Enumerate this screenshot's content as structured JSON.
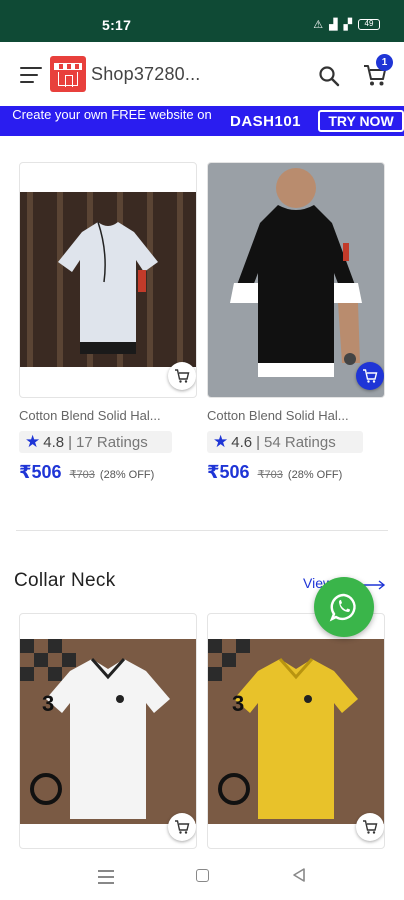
{
  "status_bar": {
    "time": "5:17",
    "battery": "49"
  },
  "header": {
    "shop_name": "Shop37280...",
    "cart_count": "1"
  },
  "promo": {
    "text": "Create your own FREE website on",
    "code": "DASH101",
    "button": "TRY NOW"
  },
  "products_top": [
    {
      "name": "Cotton Blend Solid Hal...",
      "rating": "4.8",
      "ratings_count": "17 Ratings",
      "price": "₹506",
      "old_price": "₹703",
      "discount": "(28% OFF)"
    },
    {
      "name": "Cotton Blend Solid Hal...",
      "rating": "4.6",
      "ratings_count": "54 Ratings",
      "price": "₹506",
      "old_price": "₹703",
      "discount": "(28% OFF)"
    }
  ],
  "section": {
    "title": "Collar Neck",
    "view_all": "View All"
  },
  "colors": {
    "brand_blue": "#1f35d6",
    "status_green": "#0f4a35",
    "whatsapp_green": "#3ab54a",
    "logo_red": "#e8403c"
  },
  "icons": [
    "menu-icon",
    "shop-logo",
    "search-icon",
    "cart-icon",
    "add-to-cart-icon",
    "whatsapp-icon",
    "arrow-right-icon"
  ]
}
